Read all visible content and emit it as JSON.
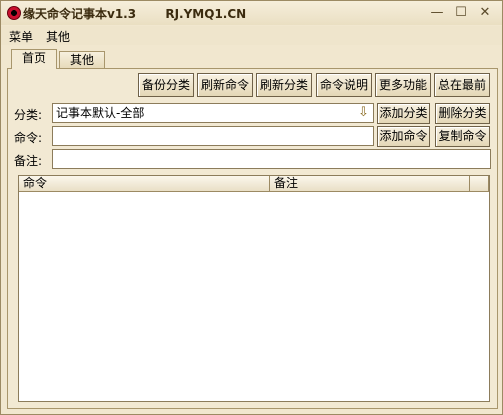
{
  "window": {
    "title": "缘天命令记事本v1.3",
    "site": "RJ.YMQ1.CN",
    "min_glyph": "—",
    "max_glyph": "☐",
    "close_glyph": "✕"
  },
  "menu": [
    "菜单",
    "其他"
  ],
  "tabs": [
    {
      "label": "首页",
      "active": true
    },
    {
      "label": "其他",
      "active": false
    }
  ],
  "toolbar": {
    "backup": "备份分类",
    "refresh_cmd": "刷新命令",
    "refresh_cat": "刷新分类",
    "cmd_help": "命令说明",
    "more": "更多功能",
    "on_top": "总在最前"
  },
  "form": {
    "category_label": "分类:",
    "category_value": "记事本默认-全部",
    "command_label": "命令:",
    "command_value": "",
    "note_label": "备注:",
    "note_value": "",
    "add_category": "添加分类",
    "delete_category": "删除分类",
    "add_command": "添加命令",
    "copy_command": "复制命令"
  },
  "list": {
    "columns": [
      "命令",
      "备注",
      ""
    ],
    "rows": []
  },
  "icons": {
    "app": "red-target-icon",
    "dropdown": "chevron-down-icon"
  }
}
